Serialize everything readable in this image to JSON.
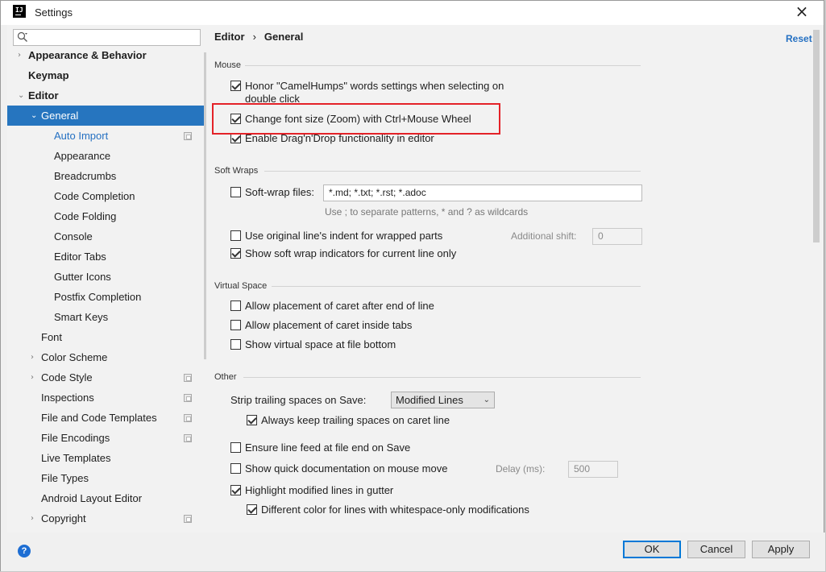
{
  "window": {
    "title": "Settings"
  },
  "search": {
    "placeholder": ""
  },
  "tree": [
    {
      "label": "Appearance & Behavior",
      "bold": true,
      "chevron": "›",
      "level": 0
    },
    {
      "label": "Keymap",
      "bold": true,
      "level": 0
    },
    {
      "label": "Editor",
      "bold": true,
      "chevron": "⌄",
      "level": 0
    },
    {
      "label": "General",
      "chevron": "⌄",
      "level": 1,
      "selected": true
    },
    {
      "label": "Auto Import",
      "level": 2,
      "link": true,
      "page_icon": true
    },
    {
      "label": "Appearance",
      "level": 2
    },
    {
      "label": "Breadcrumbs",
      "level": 2
    },
    {
      "label": "Code Completion",
      "level": 2
    },
    {
      "label": "Code Folding",
      "level": 2
    },
    {
      "label": "Console",
      "level": 2
    },
    {
      "label": "Editor Tabs",
      "level": 2
    },
    {
      "label": "Gutter Icons",
      "level": 2
    },
    {
      "label": "Postfix Completion",
      "level": 2
    },
    {
      "label": "Smart Keys",
      "level": 2
    },
    {
      "label": "Font",
      "level": 1
    },
    {
      "label": "Color Scheme",
      "chevron": "›",
      "level": 1
    },
    {
      "label": "Code Style",
      "chevron": "›",
      "level": 1,
      "page_icon": true
    },
    {
      "label": "Inspections",
      "level": 1,
      "page_icon": true
    },
    {
      "label": "File and Code Templates",
      "level": 1,
      "page_icon": true
    },
    {
      "label": "File Encodings",
      "level": 1,
      "page_icon": true
    },
    {
      "label": "Live Templates",
      "level": 1
    },
    {
      "label": "File Types",
      "level": 1
    },
    {
      "label": "Android Layout Editor",
      "level": 1
    },
    {
      "label": "Copyright",
      "chevron": "›",
      "level": 1,
      "page_icon": true
    }
  ],
  "breadcrumb": {
    "parent": "Editor",
    "sep": "›",
    "current": "General"
  },
  "reset_label": "Reset",
  "mouse": {
    "title": "Mouse",
    "camel_line1": "Honor \"CamelHumps\" words settings when selecting on",
    "camel_line2": "double click",
    "camel_checked": true,
    "zoom_label": "Change font size (Zoom) with Ctrl+Mouse Wheel",
    "zoom_checked": true,
    "dnd_label": "Enable Drag'n'Drop functionality in editor",
    "dnd_checked": true
  },
  "soft_wraps": {
    "title": "Soft Wraps",
    "files_label": "Soft-wrap files:",
    "files_checked": false,
    "files_value": "*.md; *.txt; *.rst; *.adoc",
    "hint": "Use ; to separate patterns, * and ? as wildcards",
    "indent_label": "Use original line's indent for wrapped parts",
    "indent_checked": false,
    "shift_label": "Additional shift:",
    "shift_value": "0",
    "indicators_label": "Show soft wrap indicators for current line only",
    "indicators_checked": true
  },
  "virtual_space": {
    "title": "Virtual Space",
    "after_end_label": "Allow placement of caret after end of line",
    "inside_tabs_label": "Allow placement of caret inside tabs",
    "file_bottom_label": "Show virtual space at file bottom"
  },
  "other": {
    "title": "Other",
    "strip_label": "Strip trailing spaces on Save:",
    "strip_value": "Modified Lines",
    "keep_label": "Always keep trailing spaces on caret line",
    "keep_checked": true,
    "linefeed_label": "Ensure line feed at file end on Save",
    "quickdoc_label": "Show quick documentation on mouse move",
    "delay_label": "Delay (ms):",
    "delay_value": "500",
    "highlight_label": "Highlight modified lines in gutter",
    "highlight_checked": true,
    "whitespace_label": "Different color for lines with whitespace-only modifications",
    "whitespace_checked": true
  },
  "footer": {
    "help": "?",
    "ok": "OK",
    "cancel": "Cancel",
    "apply": "Apply"
  },
  "colors": {
    "selection": "#2675bf",
    "link": "#2470c2",
    "annotation": "#e42228"
  }
}
